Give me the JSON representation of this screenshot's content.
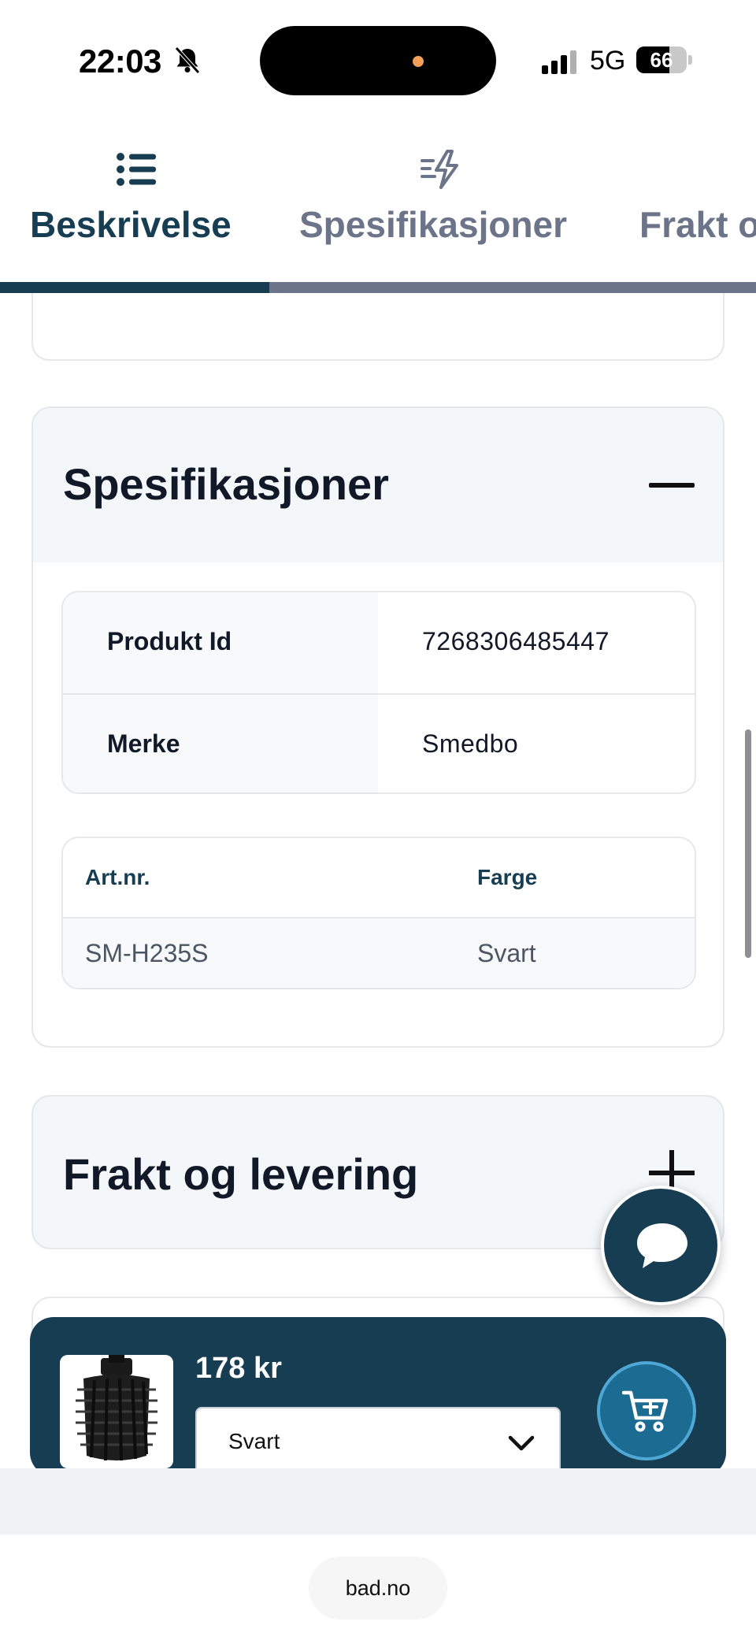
{
  "status_bar": {
    "time": "22:03",
    "network": "5G",
    "battery": "66",
    "icons": [
      "bell-muted-icon",
      "signal-icon",
      "battery-icon"
    ]
  },
  "tabs": [
    {
      "label": "Beskrivelse",
      "icon": "list-icon",
      "active": true
    },
    {
      "label": "Spesifikasjoner",
      "icon": "bolt-lines-icon",
      "active": false
    },
    {
      "label": "Frakt o",
      "icon": "",
      "active": false
    }
  ],
  "specs": {
    "title": "Spesifikasjoner",
    "toggle_icon": "minus-icon",
    "rows": [
      {
        "key": "Produkt Id",
        "value": "7268306485447"
      },
      {
        "key": "Merke",
        "value": "Smedbo"
      }
    ],
    "variants": {
      "headers": [
        "Art.nr.",
        "Farge"
      ],
      "rows": [
        [
          "SM-H235S",
          "Svart"
        ]
      ]
    }
  },
  "shipping": {
    "title": "Frakt og levering",
    "toggle_icon": "plus-icon"
  },
  "chat": {
    "icon": "chat-bubble-icon"
  },
  "cart_bar": {
    "price": "178 kr",
    "selected_option": "Svart",
    "add_icon": "cart-plus-icon"
  },
  "browser": {
    "url": "bad.no"
  },
  "colors": {
    "primary": "#173d53",
    "tab_inactive": "#6b7488",
    "accent_cart": "#1c6b93",
    "header_bg": "#f3f7f9"
  }
}
